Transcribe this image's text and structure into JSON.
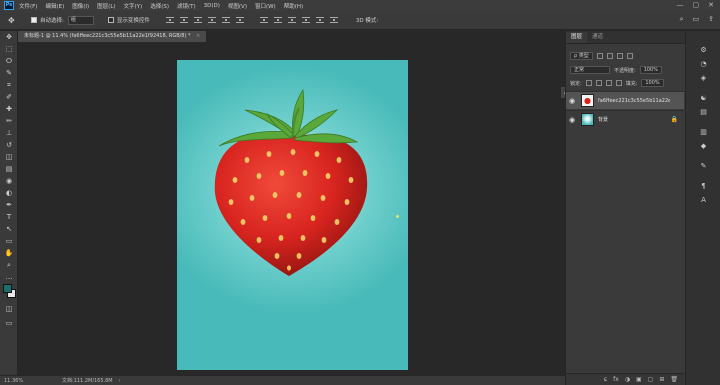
{
  "app": {
    "logo_text": "Ps"
  },
  "menu": {
    "items": [
      "文件(F)",
      "编辑(E)",
      "图像(I)",
      "图层(L)",
      "文字(Y)",
      "选择(S)",
      "滤镜(T)",
      "3D(D)",
      "视图(V)",
      "窗口(W)",
      "帮助(H)"
    ],
    "window_controls": [
      "—",
      "▢",
      "✕"
    ]
  },
  "options_bar": {
    "auto_select_label": "自动选择:",
    "auto_select_value": "组",
    "show_transform_label": "显示变换控件",
    "mode_label": "3D 模式:",
    "right_icons": [
      "⌕",
      "▭",
      "⇪"
    ]
  },
  "tools": {
    "icons": [
      "move-icon",
      "marquee-icon",
      "lasso-icon",
      "quick-select-icon",
      "crop-icon",
      "eyedropper-icon",
      "healing-icon",
      "brush-icon",
      "stamp-icon",
      "history-brush-icon",
      "eraser-icon",
      "gradient-icon",
      "blur-icon",
      "dodge-icon",
      "pen-icon",
      "type-icon",
      "path-select-icon",
      "shape-icon",
      "hand-icon",
      "zoom-icon",
      "more-icon"
    ],
    "glyphs": [
      "✥",
      "⬚",
      "ⵔ",
      "✎",
      "⌗",
      "✐",
      "✚",
      "✏",
      "⊥",
      "↺",
      "◫",
      "▤",
      "◉",
      "◐",
      "✒",
      "T",
      "↖",
      "▭",
      "✋",
      "⌕",
      "…"
    ],
    "foreground_color": "#1a6e6c",
    "background_color": "#e8e8e8"
  },
  "document": {
    "tab_title": "未标题-1 @ 11.4% (fa6ffeec221c3c55e5b11a22e1f92418, RGB/8) *",
    "close_glyph": "×"
  },
  "canvas": {
    "bg_top_color": "#48bab9",
    "glow_color": "#ecfbfb",
    "fruit_color": "#d8241f",
    "leaf_color": "#5aa83a"
  },
  "status": {
    "zoom": "11.36%",
    "doc_size": "文档:111.2M/165.8M",
    "arrow": "›"
  },
  "layers_panel": {
    "tabs": [
      "图层",
      "通道"
    ],
    "kind_label": "ρ 类型",
    "blend_mode": "正常",
    "opacity_label": "不透明度:",
    "opacity_value": "100%",
    "lock_label": "锁定:",
    "fill_label": "填充:",
    "fill_value": "100%",
    "layers": [
      {
        "name": "fa6ffeec221c3c55e5b11a22e1f92418",
        "visible_glyph": "◉",
        "selected": true
      },
      {
        "name": "背景",
        "visible_glyph": "◉",
        "lock_glyph": "🔒"
      }
    ],
    "footer_icons": [
      "ɕ",
      "fx",
      "◑",
      "▣",
      "▢",
      "⊞",
      "🗑"
    ]
  },
  "dock": {
    "icons": [
      "⚙",
      "◔",
      "◈",
      "☯",
      "▤",
      "▥",
      "◆",
      "✎",
      "¶",
      "A"
    ]
  }
}
